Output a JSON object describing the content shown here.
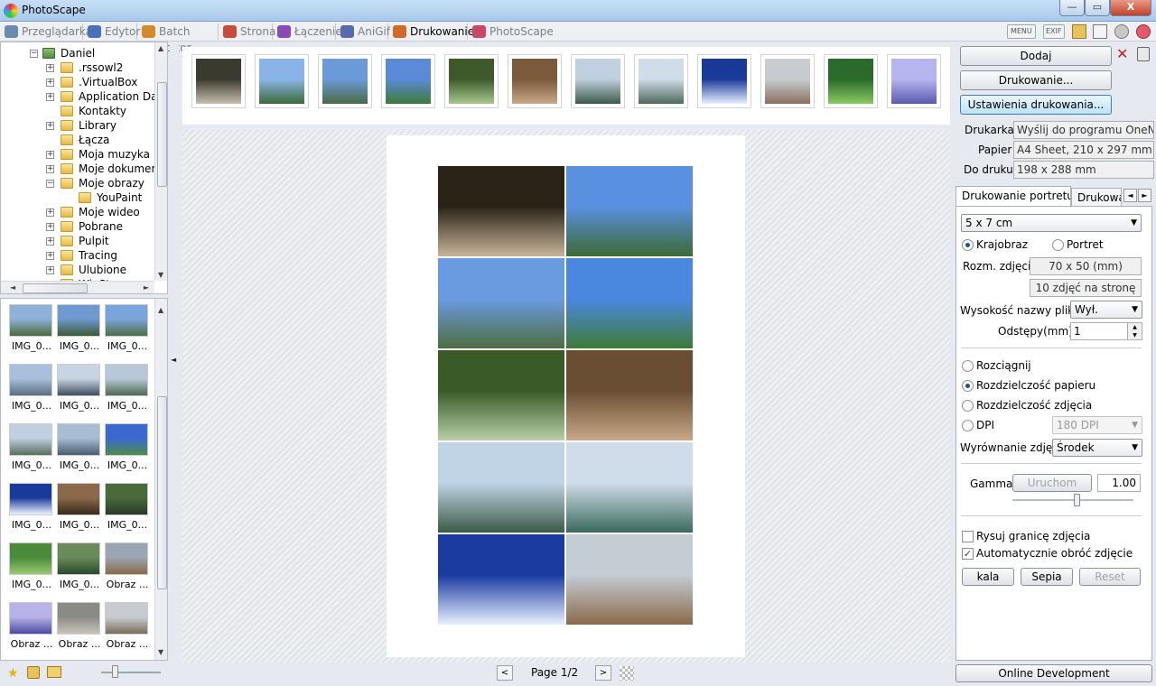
{
  "window": {
    "title": "PhotoScape",
    "minimize": "—",
    "maximize": "▭",
    "close": "X"
  },
  "tabs": [
    {
      "label": "Przeglądarka",
      "color": "#6a8bb0"
    },
    {
      "label": "Edytor",
      "color": "#4a72b8"
    },
    {
      "label": "Batch Editor",
      "color": "#d28a2c"
    },
    {
      "label": "Strona",
      "color": "#c84a3a"
    },
    {
      "label": "Łączenie",
      "color": "#8a4ab8"
    },
    {
      "label": "AniGif",
      "color": "#5a6ab0"
    },
    {
      "label": "Drukowanie",
      "color": "#d06a2a"
    },
    {
      "label": "PhotoScape",
      "color": "#c8486a"
    }
  ],
  "top_icons": [
    {
      "name": "menu-icon",
      "text": "MENU"
    },
    {
      "name": "exif-icon",
      "text": "EXIF"
    },
    {
      "name": "folder-preview-icon",
      "text": ""
    },
    {
      "name": "copy-icon",
      "text": ""
    },
    {
      "name": "settings-icon",
      "text": ""
    },
    {
      "name": "help-icon",
      "text": ""
    }
  ],
  "tree": {
    "root": "Daniel",
    "items": [
      {
        "label": ".rssowl2",
        "expander": true
      },
      {
        "label": ".VirtualBox",
        "expander": true
      },
      {
        "label": "Application Dat",
        "expander": true
      },
      {
        "label": "Kontakty",
        "expander": false
      },
      {
        "label": "Library",
        "expander": true
      },
      {
        "label": "Łącza",
        "expander": false
      },
      {
        "label": "Moja muzyka",
        "expander": true
      },
      {
        "label": "Moje dokument",
        "expander": true
      },
      {
        "label": "Moje obrazy",
        "expander": true,
        "expanded": true
      },
      {
        "label": "YouPaint",
        "expander": false,
        "child": true
      },
      {
        "label": "Moje wideo",
        "expander": true
      },
      {
        "label": "Pobrane",
        "expander": true
      },
      {
        "label": "Pulpit",
        "expander": true
      },
      {
        "label": "Tracing",
        "expander": true
      },
      {
        "label": "Ulubione",
        "expander": true
      },
      {
        "label": "WinStar",
        "expander": true
      }
    ]
  },
  "gallery": {
    "items": [
      {
        "label": "IMG_0...",
        "colors": [
          "#8fb0d8",
          "#4a6a3a"
        ]
      },
      {
        "label": "IMG_0...",
        "colors": [
          "#6f9ad0",
          "#3c5a38"
        ]
      },
      {
        "label": "IMG_0...",
        "colors": [
          "#7aa4dc",
          "#4e6e46"
        ]
      },
      {
        "label": "IMG_0...",
        "colors": [
          "#a8c0dc",
          "#5a6e7e"
        ]
      },
      {
        "label": "IMG_0...",
        "colors": [
          "#c8d4e2",
          "#3e4e5e"
        ]
      },
      {
        "label": "IMG_0...",
        "colors": [
          "#b8c8d8",
          "#4e6a4e"
        ]
      },
      {
        "label": "IMG_0...",
        "colors": [
          "#c0d0e0",
          "#5a6e5e"
        ]
      },
      {
        "label": "IMG_0...",
        "colors": [
          "#a8bcd4",
          "#4a5e6e"
        ]
      },
      {
        "label": "IMG_0...",
        "colors": [
          "#3a6ad0",
          "#4e8a4a"
        ]
      },
      {
        "label": "IMG_0...",
        "colors": [
          "#1a3a9a",
          "#f0f4ff"
        ]
      },
      {
        "label": "IMG_0...",
        "colors": [
          "#8a6a4a",
          "#3a2a1a"
        ]
      },
      {
        "label": "IMG_0...",
        "colors": [
          "#4a6a3a",
          "#2a3a2a"
        ]
      },
      {
        "label": "IMG_0...",
        "colors": [
          "#4a8a3a",
          "#9ac870"
        ]
      },
      {
        "label": "IMG_0...",
        "colors": [
          "#6a8a5a",
          "#2a4a2a"
        ]
      },
      {
        "label": "Obraz ...",
        "colors": [
          "#9aa6b4",
          "#8a6a4a"
        ]
      },
      {
        "label": "Obraz ...",
        "colors": [
          "#b8b4e8",
          "#4a4aa0"
        ]
      },
      {
        "label": "Obraz ...",
        "colors": [
          "#8a8a86",
          "#c8c4b8"
        ]
      },
      {
        "label": "Obraz ...",
        "colors": [
          "#c8ccd0",
          "#7a6e5e"
        ]
      },
      {
        "label": "",
        "colors": [
          "#6a8ac0",
          "#c0d0e0"
        ]
      },
      {
        "label": "",
        "colors": [
          "#5a5a4a",
          "#2a2a20"
        ]
      },
      {
        "label": "",
        "colors": [
          "#a05a4a",
          "#e8e0d8"
        ]
      }
    ]
  },
  "strip": [
    {
      "colors": [
        "#3a3a30",
        "#c8c0b0"
      ]
    },
    {
      "colors": [
        "#8ab4e8",
        "#3e6a3a"
      ]
    },
    {
      "colors": [
        "#6a9ad8",
        "#4a6a48"
      ]
    },
    {
      "colors": [
        "#5a8ad8",
        "#3e7a3a"
      ]
    },
    {
      "colors": [
        "#3e5a2a",
        "#a8c890"
      ]
    },
    {
      "colors": [
        "#7a5a3a",
        "#c8a888"
      ]
    },
    {
      "colors": [
        "#c0d0e0",
        "#3e5a4a"
      ]
    },
    {
      "colors": [
        "#d0dce8",
        "#4e6a5e"
      ]
    },
    {
      "colors": [
        "#1a3a9a",
        "#e8f0ff"
      ]
    },
    {
      "colors": [
        "#c8ccd0",
        "#8a7060"
      ]
    },
    {
      "colors": [
        "#2a6a2a",
        "#8ac860"
      ]
    },
    {
      "colors": [
        "#b8b4f0",
        "#5a5ab0"
      ]
    }
  ],
  "layout_photos": [
    {
      "colors": [
        "#2a2418",
        "#c8b49a"
      ]
    },
    {
      "colors": [
        "#5a90e0",
        "#3c6a36"
      ]
    },
    {
      "colors": [
        "#6a9ae0",
        "#4e6e42"
      ]
    },
    {
      "colors": [
        "#4a88e0",
        "#3e7a36"
      ]
    },
    {
      "colors": [
        "#3a5a28",
        "#b8d0a8"
      ]
    },
    {
      "colors": [
        "#6a4e34",
        "#c8a888"
      ]
    },
    {
      "colors": [
        "#c0d4e6",
        "#3a5a46"
      ]
    },
    {
      "colors": [
        "#d0dcea",
        "#3a6a5a"
      ]
    },
    {
      "colors": [
        "#1a3aa0",
        "#e8f0ff"
      ]
    },
    {
      "colors": [
        "#c4ccd4",
        "#8a6a4a"
      ]
    }
  ],
  "pager": {
    "prev": "<",
    "label": "Page 1/2",
    "next": ">"
  },
  "right": {
    "add_button": "Dodaj",
    "print_button": "Drukowanie...",
    "print_settings_button": "Ustawienia drukowania...",
    "printer_label": "Drukarka",
    "printer_value": "Wyślij do programu OneNote",
    "paper_label": "Papier",
    "paper_value": "A4 Sheet, 210 x 297 mm",
    "print_area_label": "Do druku",
    "print_area_value": "198 x 288 mm",
    "tab_portrait": "Drukowanie portretu",
    "tab_other": "Drukowanie",
    "size_select": "5 x 7 cm",
    "orientation_landscape": "Krajobraz",
    "orientation_portrait": "Portret",
    "photo_size_label": "Rozm. zdjęcia",
    "photo_size_value": "70 x 50 (mm)",
    "photos_per_page": "10 zdjęć na stronę",
    "filename_height_label": "Wysokość nazwy pliku",
    "filename_height_value": "Wył.",
    "spacing_label": "Odstępy(mm)",
    "spacing_value": "1",
    "stretch": "Rozciągnij",
    "paper_resolution": "Rozdzielczość papieru",
    "photo_resolution": "Rozdzielczość zdjęcia",
    "dpi": "DPI",
    "dpi_value": "180 DPI",
    "align_label": "Wyrównanie zdjęć",
    "align_value": "Środek",
    "gamma_label": "Gamma",
    "run_button": "Uruchom",
    "gamma_value": "1.00",
    "gamma_level": 0.53,
    "draw_border": "Rysuj granicę zdjęcia",
    "auto_rotate": "Automatycznie obróć zdjęcie",
    "grayscale_button": "kala szarośc",
    "sepia_button": "Sepia",
    "reset_button": "Reset",
    "online_button": "Online Development"
  }
}
